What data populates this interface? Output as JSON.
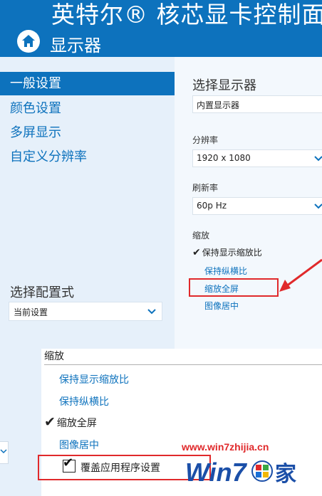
{
  "header": {
    "app_title": "英特尔® 核芯显卡控制面板",
    "page_title": "显示器"
  },
  "sidebar": {
    "items": [
      {
        "label": "一般设置",
        "active": true
      },
      {
        "label": "颜色设置",
        "active": false
      },
      {
        "label": "多屏显示",
        "active": false
      },
      {
        "label": "自定义分辨率",
        "active": false
      }
    ],
    "profile_label": "选择配置式",
    "profile_value": "当前设置"
  },
  "right": {
    "display_label": "选择显示器",
    "display_value": "内置显示器",
    "resolution_label": "分辨率",
    "resolution_value": "1920 x 1080",
    "refresh_label": "刷新率",
    "refresh_value": "60p Hz",
    "scale_label": "缩放",
    "scale_options": [
      {
        "label": "保持显示缩放比",
        "checked": true
      },
      {
        "label": "保持纵横比",
        "checked": false
      },
      {
        "label": "缩放全屏",
        "checked": false
      },
      {
        "label": "图像居中",
        "checked": false
      }
    ]
  },
  "bottom": {
    "scale_label": "缩放",
    "scale_options": [
      {
        "label": "保持显示缩放比",
        "checked": false
      },
      {
        "label": "保持纵横比",
        "checked": false
      },
      {
        "label": "缩放全屏",
        "checked": true
      },
      {
        "label": "图像居中",
        "checked": false
      }
    ],
    "override_label": "覆盖应用程序设置",
    "override_checked": true
  },
  "watermark": {
    "url": "www.win7zhijia.cn",
    "logo_text": "Win7",
    "logo_suffix": "家"
  },
  "colors": {
    "accent": "#0d72bd",
    "highlight": "#e0292b",
    "panel_bg": "#e6f0fa"
  },
  "icons": [
    "home-icon",
    "chevron-down-icon",
    "checkmark-icon",
    "annotation-arrow"
  ]
}
